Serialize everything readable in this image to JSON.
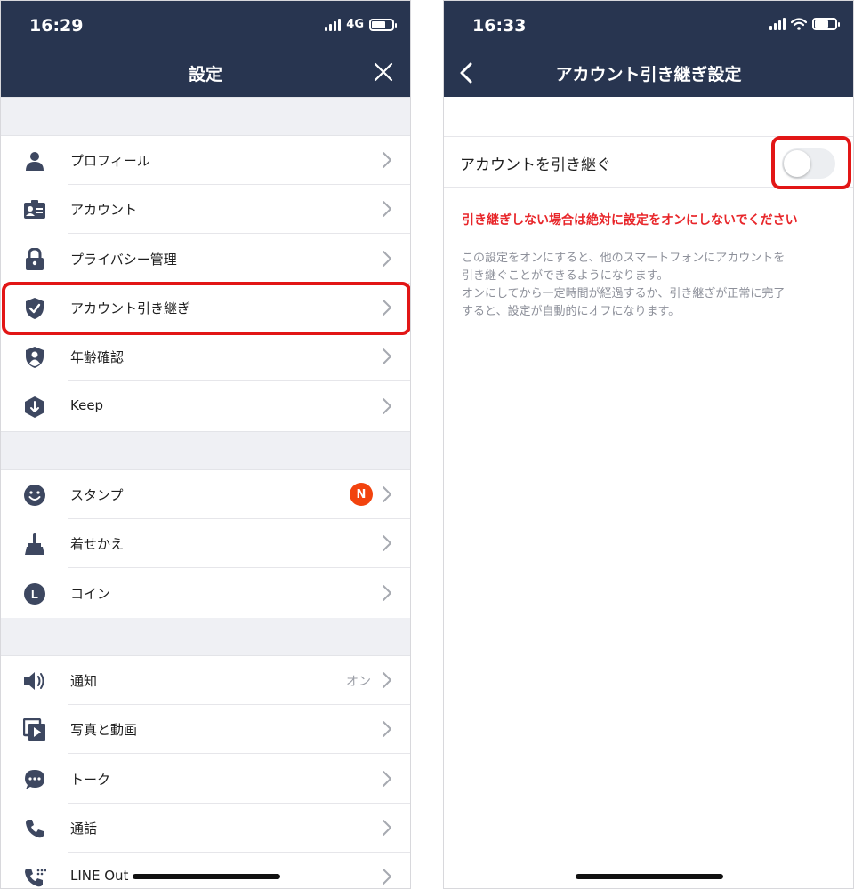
{
  "left_screen": {
    "status": {
      "time": "16:29",
      "network": "4G"
    },
    "title": "設定",
    "groups": [
      {
        "items": [
          {
            "label": "プロフィール",
            "icon": "person-icon"
          },
          {
            "label": "アカウント",
            "icon": "id-card-icon"
          },
          {
            "label": "プライバシー管理",
            "icon": "lock-icon"
          },
          {
            "label": "アカウント引き継ぎ",
            "icon": "shield-check-icon"
          },
          {
            "label": "年齢確認",
            "icon": "shield-person-icon"
          },
          {
            "label": "Keep",
            "icon": "download-hexagon-icon"
          }
        ]
      },
      {
        "items": [
          {
            "label": "スタンプ",
            "icon": "smiley-icon",
            "badge": "N"
          },
          {
            "label": "着せかえ",
            "icon": "brush-icon"
          },
          {
            "label": "コイン",
            "icon": "coin-icon",
            "icon_text": "L"
          }
        ]
      },
      {
        "items": [
          {
            "label": "通知",
            "icon": "speaker-icon",
            "value": "オン"
          },
          {
            "label": "写真と動画",
            "icon": "media-icon"
          },
          {
            "label": "トーク",
            "icon": "chat-bubble-icon"
          },
          {
            "label": "通話",
            "icon": "phone-icon"
          },
          {
            "label": "LINE Out",
            "icon": "phone-out-icon"
          }
        ]
      }
    ]
  },
  "right_screen": {
    "status": {
      "time": "16:33"
    },
    "title": "アカウント引き継ぎ設定",
    "toggle_label": "アカウントを引き継ぐ",
    "toggle_on": false,
    "warning": "引き継ぎしない場合は絶対に設定をオンにしないでください",
    "description_lines": [
      "この設定をオンにすると、他のスマートフォンにアカウントを",
      "引き継ぐことができるようになります。",
      "オンにしてから一定時間が経過するか、引き継ぎが正常に完了",
      "すると、設定が自動的にオフになります。"
    ]
  },
  "colors": {
    "header": "#283550",
    "icon": "#3d4760",
    "highlight": "#e21616",
    "warning": "#e8262a",
    "badge": "#f2430e"
  }
}
